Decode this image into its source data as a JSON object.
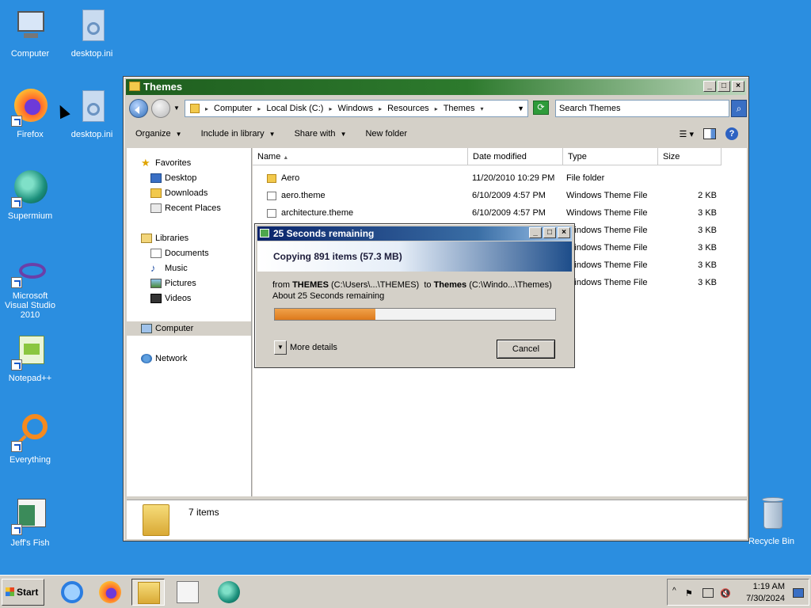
{
  "desktop": {
    "icons": [
      {
        "label": "Computer"
      },
      {
        "label": "desktop.ini"
      },
      {
        "label": "Firefox"
      },
      {
        "label": "desktop.ini"
      },
      {
        "label": "Supermium"
      },
      {
        "label": "Microsoft Visual Studio 2010"
      },
      {
        "label": "Notepad++"
      },
      {
        "label": "Everything"
      },
      {
        "label": "Jeff's Fish"
      },
      {
        "label": "Recycle Bin"
      }
    ]
  },
  "explorer": {
    "title": "Themes",
    "breadcrumb": [
      "Computer",
      "Local Disk (C:)",
      "Windows",
      "Resources",
      "Themes"
    ],
    "search_placeholder": "Search Themes",
    "commands": {
      "organize": "Organize",
      "include": "Include in library",
      "share": "Share with",
      "new_folder": "New folder"
    },
    "nav": {
      "favorites": "Favorites",
      "desktop": "Desktop",
      "downloads": "Downloads",
      "recent": "Recent Places",
      "libraries": "Libraries",
      "documents": "Documents",
      "music": "Music",
      "pictures": "Pictures",
      "videos": "Videos",
      "computer": "Computer",
      "network": "Network"
    },
    "columns": {
      "name": "Name",
      "date": "Date modified",
      "type": "Type",
      "size": "Size"
    },
    "files": [
      {
        "name": "Aero",
        "date": "11/20/2010 10:29 PM",
        "type": "File folder",
        "size": ""
      },
      {
        "name": "aero.theme",
        "date": "6/10/2009 4:57 PM",
        "type": "Windows Theme File",
        "size": "2 KB"
      },
      {
        "name": "architecture.theme",
        "date": "6/10/2009 4:57 PM",
        "type": "Windows Theme File",
        "size": "3 KB"
      },
      {
        "name": "",
        "date": "",
        "type": "Windows Theme File",
        "size": "3 KB"
      },
      {
        "name": "",
        "date": "",
        "type": "Windows Theme File",
        "size": "3 KB"
      },
      {
        "name": "",
        "date": "",
        "type": "Windows Theme File",
        "size": "3 KB"
      },
      {
        "name": "",
        "date": "",
        "type": "Windows Theme File",
        "size": "3 KB"
      }
    ],
    "status": "7 items"
  },
  "copy_dialog": {
    "title": "25 Seconds remaining",
    "heading": "Copying 891 items (57.3 MB)",
    "from_label": "from",
    "from_name": "THEMES",
    "from_path": "(C:\\Users\\...\\THEMES)",
    "to_label": "to",
    "to_name": "Themes",
    "to_path": "(C:\\Windo...\\Themes)",
    "remaining": "About 25 Seconds remaining",
    "progress_fraction": 0.36,
    "more_details": "More details",
    "cancel": "Cancel"
  },
  "taskbar": {
    "start": "Start",
    "time": "1:19 AM",
    "date": "7/30/2024"
  }
}
